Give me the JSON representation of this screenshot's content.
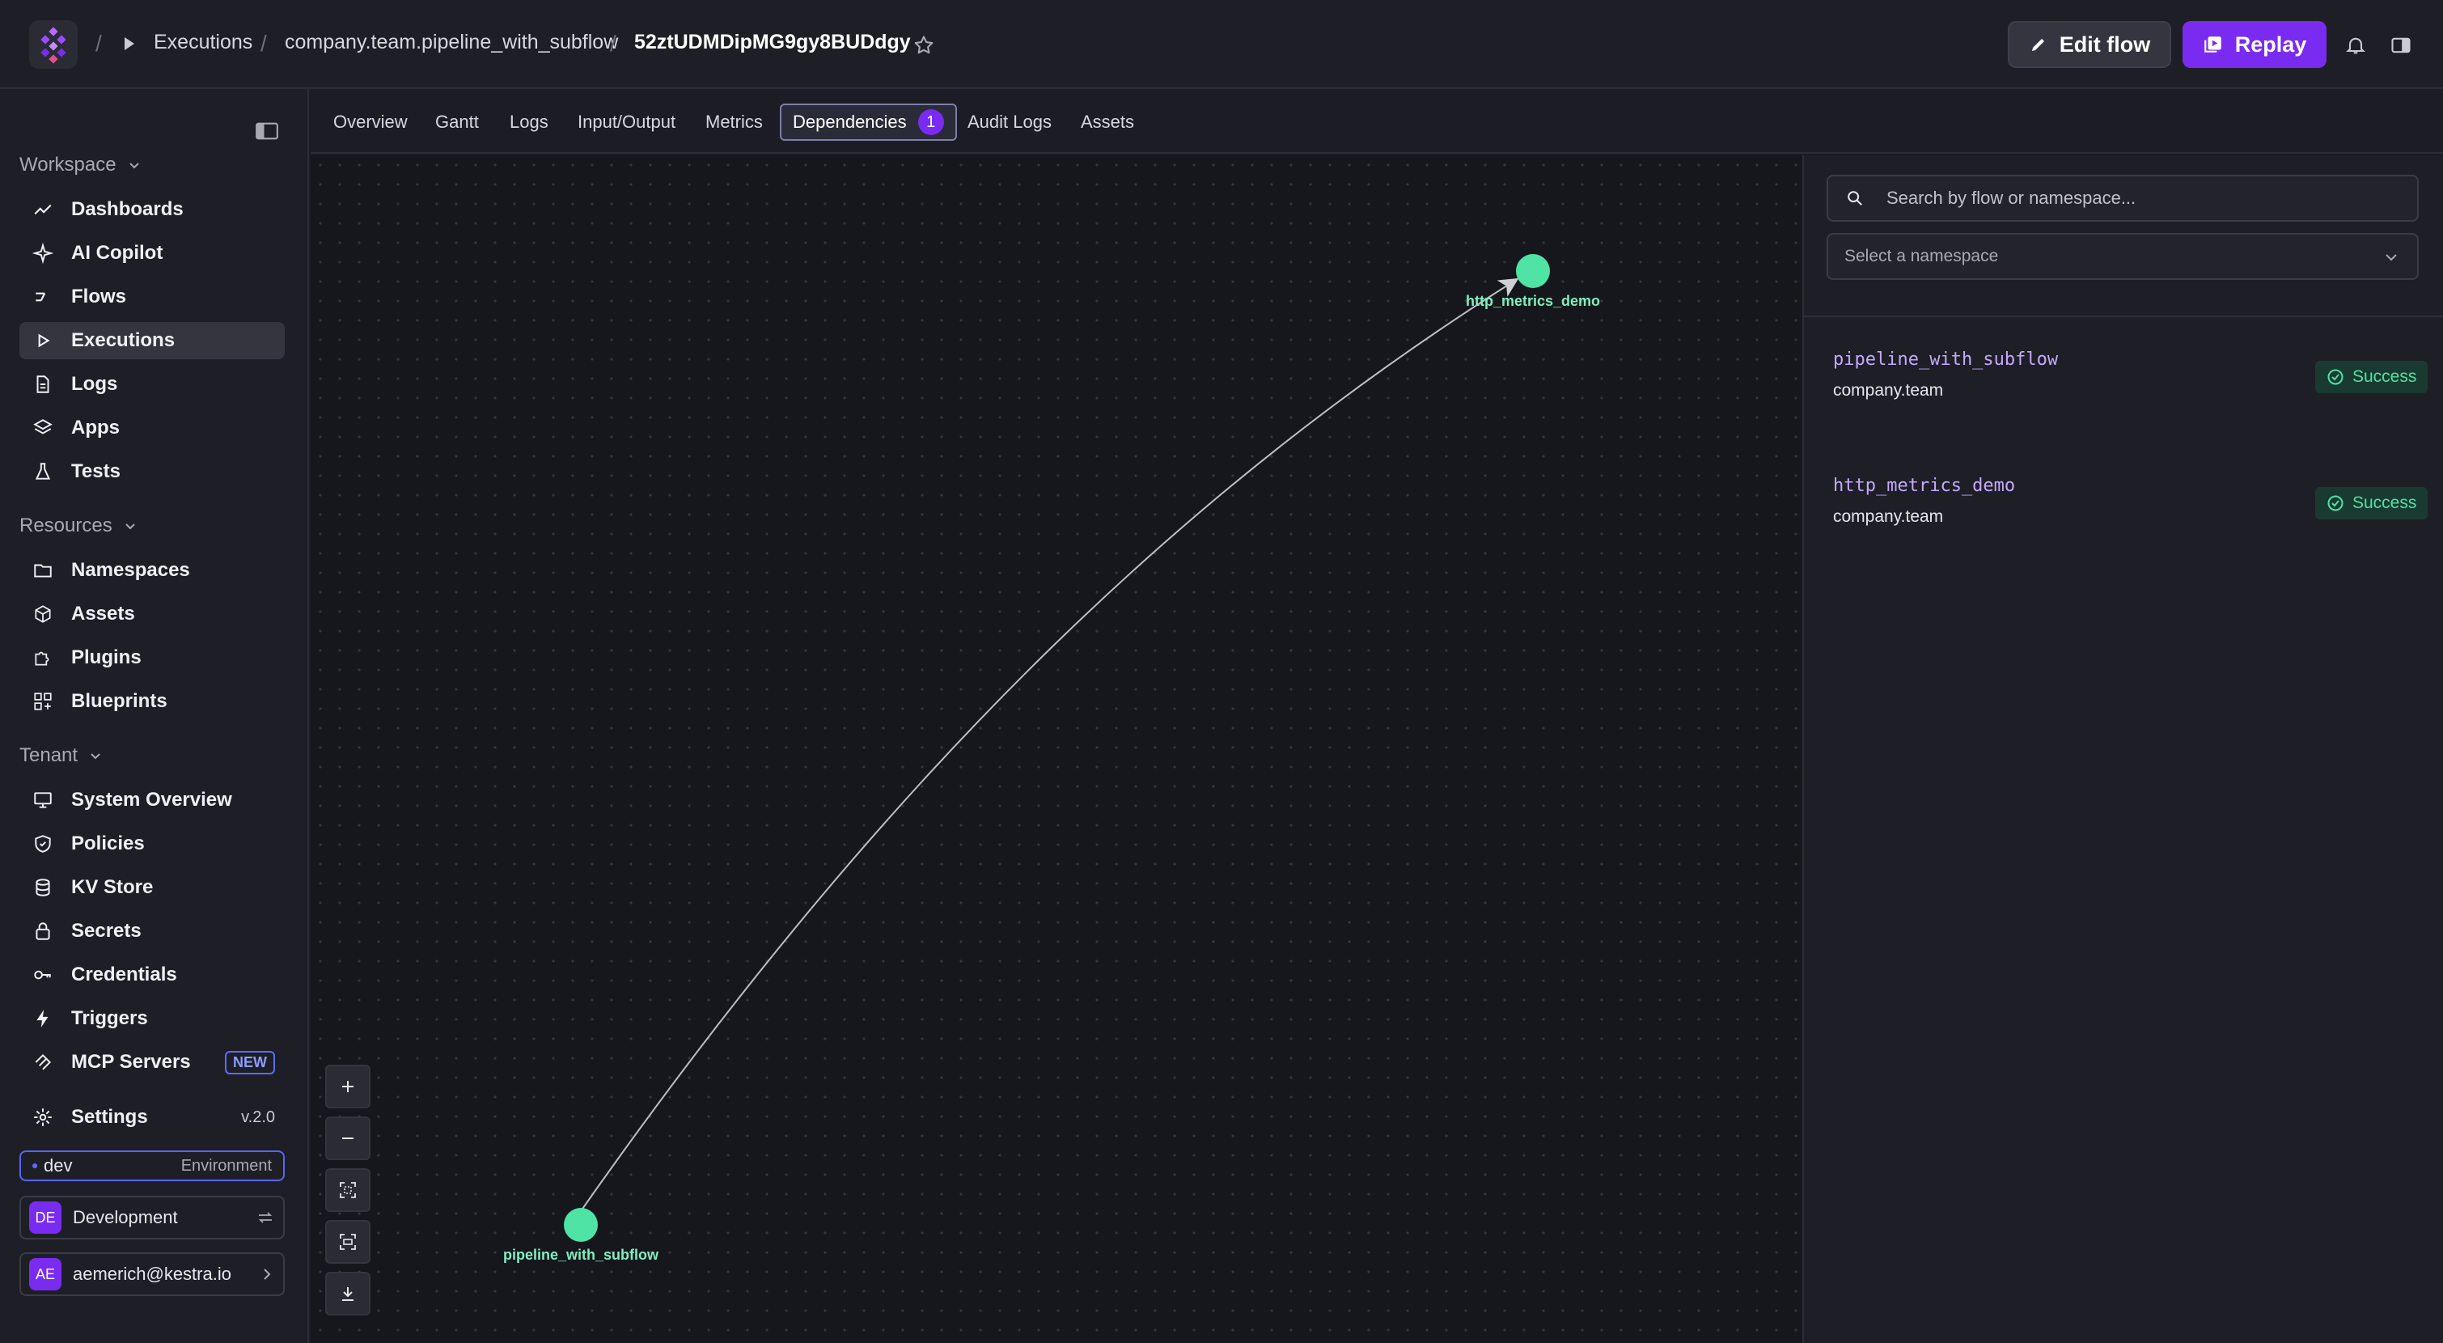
{
  "breadcrumb": {
    "section": "Executions",
    "flow": "company.team.pipeline_with_subflow",
    "execution_id": "52ztUDMDipMG9gy8BUDdgy",
    "separator": "/"
  },
  "actions": {
    "edit_flow": "Edit flow",
    "replay": "Replay"
  },
  "sidebar": {
    "workspace": {
      "title": "Workspace",
      "items": [
        {
          "label": "Dashboards",
          "icon": "chart-line-icon"
        },
        {
          "label": "AI Copilot",
          "icon": "sparkle-icon"
        },
        {
          "label": "Flows",
          "icon": "flow-icon"
        },
        {
          "label": "Executions",
          "icon": "play-icon",
          "active": true
        },
        {
          "label": "Logs",
          "icon": "file-text-icon"
        },
        {
          "label": "Apps",
          "icon": "layers-icon"
        },
        {
          "label": "Tests",
          "icon": "flask-icon"
        }
      ]
    },
    "resources": {
      "title": "Resources",
      "items": [
        {
          "label": "Namespaces",
          "icon": "folder-icon"
        },
        {
          "label": "Assets",
          "icon": "cube-icon"
        },
        {
          "label": "Plugins",
          "icon": "puzzle-icon"
        },
        {
          "label": "Blueprints",
          "icon": "blueprint-icon"
        }
      ]
    },
    "tenant": {
      "title": "Tenant",
      "items": [
        {
          "label": "System Overview",
          "icon": "monitor-icon"
        },
        {
          "label": "Policies",
          "icon": "shield-icon"
        },
        {
          "label": "KV Store",
          "icon": "database-icon"
        },
        {
          "label": "Secrets",
          "icon": "lock-icon"
        },
        {
          "label": "Credentials",
          "icon": "key-icon"
        },
        {
          "label": "Triggers",
          "icon": "bolt-icon"
        },
        {
          "label": "MCP Servers",
          "icon": "mcp-icon",
          "badge": "NEW"
        }
      ]
    },
    "settings": {
      "label": "Settings",
      "version": "v.2.0"
    },
    "environment": {
      "name": "dev",
      "label": "Environment"
    },
    "tenant_switch": {
      "initials": "DE",
      "name": "Development"
    },
    "user": {
      "initials": "AE",
      "email": "aemerich@kestra.io"
    }
  },
  "tabs": [
    {
      "label": "Overview"
    },
    {
      "label": "Gantt"
    },
    {
      "label": "Logs"
    },
    {
      "label": "Input/Output"
    },
    {
      "label": "Metrics"
    },
    {
      "label": "Dependencies",
      "active": true,
      "count": "1"
    },
    {
      "label": "Audit Logs"
    },
    {
      "label": "Assets"
    }
  ],
  "graph": {
    "nodes": [
      {
        "id": "http_metrics_demo"
      },
      {
        "id": "pipeline_with_subflow"
      }
    ],
    "edges": [
      {
        "from": "pipeline_with_subflow",
        "to": "http_metrics_demo"
      }
    ],
    "node_color": "#4fe3a5"
  },
  "panel": {
    "search_placeholder": "Search by flow or namespace...",
    "namespace_placeholder": "Select a namespace",
    "flows": [
      {
        "id": "pipeline_with_subflow",
        "namespace": "company.team",
        "status": "Success"
      },
      {
        "id": "http_metrics_demo",
        "namespace": "company.team",
        "status": "Success"
      }
    ]
  },
  "colors": {
    "accent": "#7a2bf0",
    "success": "#4fe3a5",
    "flow_id": "#c4a8ff"
  }
}
